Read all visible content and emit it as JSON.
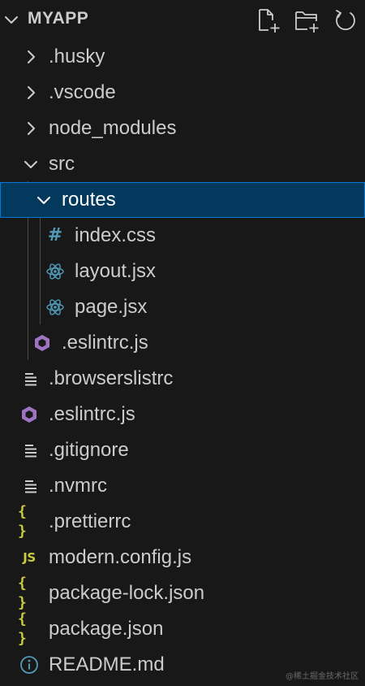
{
  "explorer": {
    "title": "MYAPP",
    "actions": [
      {
        "name": "new-file",
        "icon": "new-file-icon"
      },
      {
        "name": "new-folder",
        "icon": "new-folder-icon"
      },
      {
        "name": "refresh",
        "icon": "refresh-icon"
      }
    ]
  },
  "tree": {
    "husky": ".husky",
    "vscode": ".vscode",
    "node_modules": "node_modules",
    "src": "src",
    "routes": "routes",
    "index_css": "index.css",
    "layout_jsx": "layout.jsx",
    "page_jsx": "page.jsx",
    "src_eslintrc": ".eslintrc.js",
    "browserslistrc": ".browserslistrc",
    "eslintrc": ".eslintrc.js",
    "gitignore": ".gitignore",
    "nvmrc": ".nvmrc",
    "prettierrc": ".prettierrc",
    "modern_config": "modern.config.js",
    "package_lock": "package-lock.json",
    "package_json": "package.json",
    "readme": "README.md"
  },
  "icons": {
    "css_glyph": "#",
    "json_glyph": "{ }",
    "js_glyph": "JS"
  },
  "watermark": "@稀土掘金技术社区",
  "colors": {
    "background": "#181818",
    "selected_bg": "#04395e",
    "selected_border": "#0078d4",
    "react_icon": "#519aba",
    "json_icon": "#cbcb41",
    "eslint_icon": "#a074c4"
  }
}
